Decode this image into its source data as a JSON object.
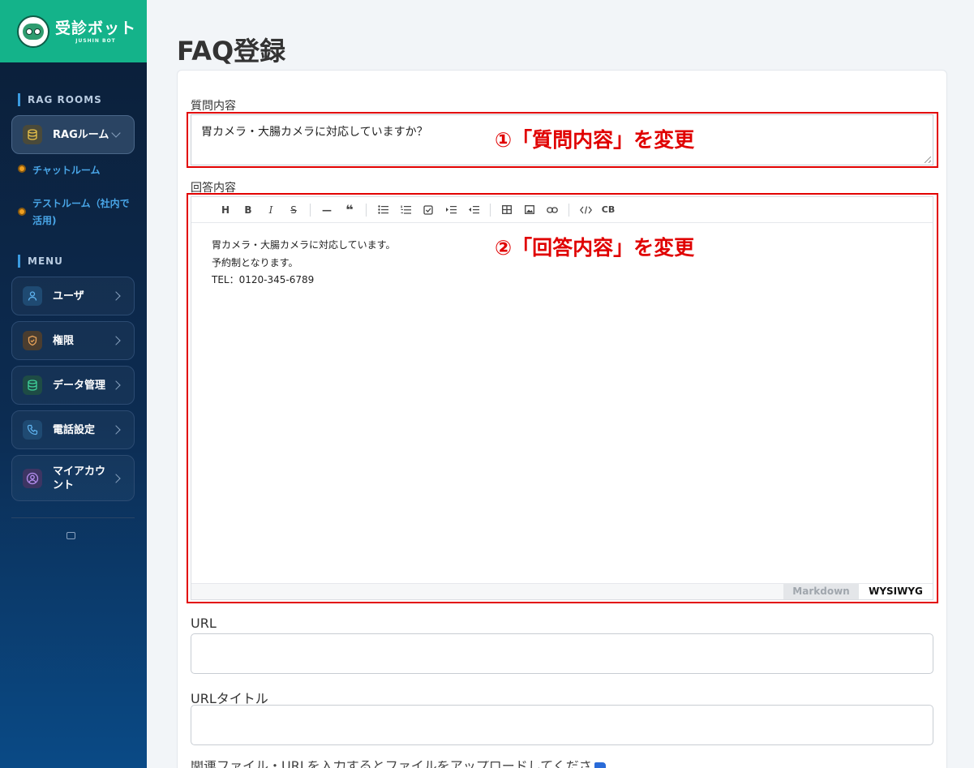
{
  "brand": {
    "name": "受診ボット",
    "sub": "JUSHIN BOT"
  },
  "sidebar": {
    "rag_section": "RAG ROOMS",
    "rag_room": {
      "label": "RAGルーム",
      "icon": "database-icon"
    },
    "sub_items": [
      {
        "label": "チャットルーム"
      },
      {
        "label": "テストルーム（社内で活用)"
      }
    ],
    "menu_section": "MENU",
    "menu_items": [
      {
        "label": "ユーザ",
        "icon": "user-icon"
      },
      {
        "label": "権限",
        "icon": "shield-icon"
      },
      {
        "label": "データ管理",
        "icon": "database-icon"
      },
      {
        "label": "電話設定",
        "icon": "phone-icon"
      },
      {
        "label": "マイアカウント",
        "icon": "account-icon"
      }
    ]
  },
  "page": {
    "title": "FAQ登録"
  },
  "form": {
    "question_label": "質問内容",
    "question_value": "胃カメラ・大腸カメラに対応していますか？",
    "answer_label": "回答内容",
    "answer_lines": [
      "胃カメラ・大腸カメラに対応しています。",
      "予約制となります。",
      "TEL：0120-345-6789"
    ],
    "toolbar": [
      "H",
      "B",
      "I",
      "S",
      "—",
      "❝",
      "list",
      "ordered-list",
      "task",
      "indent",
      "outdent",
      "table",
      "image",
      "link",
      "code",
      "CB"
    ],
    "mode_markdown": "Markdown",
    "mode_wysiwyg": "WYSIWYG",
    "url_label": "URL",
    "url_value": "",
    "url_title_label": "URLタイトル",
    "url_title_value": "",
    "cutoff_label": "関連ファイル・URLを入力するとファイルをアップロードしてください。"
  },
  "annotations": {
    "a1": "①「質問内容」を変更",
    "a2": "②「回答内容」を変更"
  },
  "colors": {
    "highlight": "#e20000",
    "brand": "#14b38a",
    "sidebar": "#0c2c52"
  }
}
